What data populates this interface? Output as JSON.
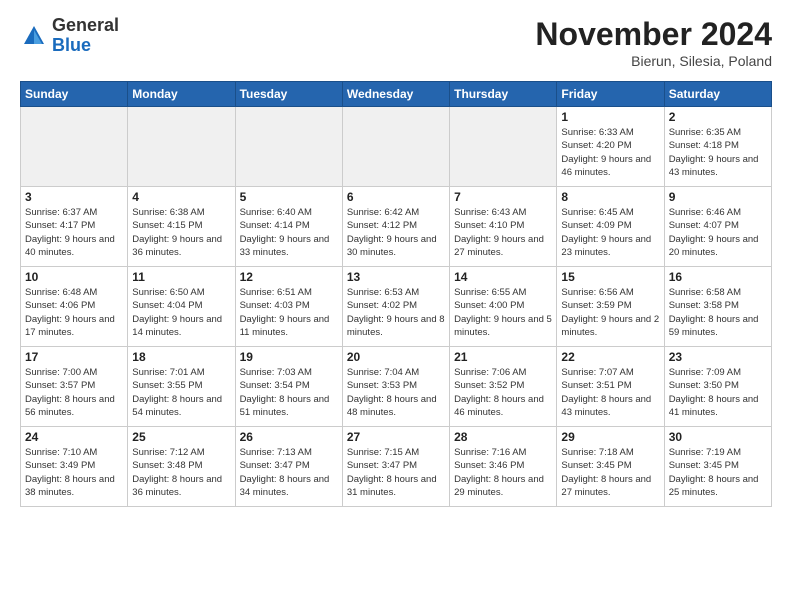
{
  "header": {
    "logo_general": "General",
    "logo_blue": "Blue",
    "month_title": "November 2024",
    "location": "Bierun, Silesia, Poland"
  },
  "weekdays": [
    "Sunday",
    "Monday",
    "Tuesday",
    "Wednesday",
    "Thursday",
    "Friday",
    "Saturday"
  ],
  "weeks": [
    [
      {
        "day": "",
        "info": ""
      },
      {
        "day": "",
        "info": ""
      },
      {
        "day": "",
        "info": ""
      },
      {
        "day": "",
        "info": ""
      },
      {
        "day": "",
        "info": ""
      },
      {
        "day": "1",
        "info": "Sunrise: 6:33 AM\nSunset: 4:20 PM\nDaylight: 9 hours and 46 minutes."
      },
      {
        "day": "2",
        "info": "Sunrise: 6:35 AM\nSunset: 4:18 PM\nDaylight: 9 hours and 43 minutes."
      }
    ],
    [
      {
        "day": "3",
        "info": "Sunrise: 6:37 AM\nSunset: 4:17 PM\nDaylight: 9 hours and 40 minutes."
      },
      {
        "day": "4",
        "info": "Sunrise: 6:38 AM\nSunset: 4:15 PM\nDaylight: 9 hours and 36 minutes."
      },
      {
        "day": "5",
        "info": "Sunrise: 6:40 AM\nSunset: 4:14 PM\nDaylight: 9 hours and 33 minutes."
      },
      {
        "day": "6",
        "info": "Sunrise: 6:42 AM\nSunset: 4:12 PM\nDaylight: 9 hours and 30 minutes."
      },
      {
        "day": "7",
        "info": "Sunrise: 6:43 AM\nSunset: 4:10 PM\nDaylight: 9 hours and 27 minutes."
      },
      {
        "day": "8",
        "info": "Sunrise: 6:45 AM\nSunset: 4:09 PM\nDaylight: 9 hours and 23 minutes."
      },
      {
        "day": "9",
        "info": "Sunrise: 6:46 AM\nSunset: 4:07 PM\nDaylight: 9 hours and 20 minutes."
      }
    ],
    [
      {
        "day": "10",
        "info": "Sunrise: 6:48 AM\nSunset: 4:06 PM\nDaylight: 9 hours and 17 minutes."
      },
      {
        "day": "11",
        "info": "Sunrise: 6:50 AM\nSunset: 4:04 PM\nDaylight: 9 hours and 14 minutes."
      },
      {
        "day": "12",
        "info": "Sunrise: 6:51 AM\nSunset: 4:03 PM\nDaylight: 9 hours and 11 minutes."
      },
      {
        "day": "13",
        "info": "Sunrise: 6:53 AM\nSunset: 4:02 PM\nDaylight: 9 hours and 8 minutes."
      },
      {
        "day": "14",
        "info": "Sunrise: 6:55 AM\nSunset: 4:00 PM\nDaylight: 9 hours and 5 minutes."
      },
      {
        "day": "15",
        "info": "Sunrise: 6:56 AM\nSunset: 3:59 PM\nDaylight: 9 hours and 2 minutes."
      },
      {
        "day": "16",
        "info": "Sunrise: 6:58 AM\nSunset: 3:58 PM\nDaylight: 8 hours and 59 minutes."
      }
    ],
    [
      {
        "day": "17",
        "info": "Sunrise: 7:00 AM\nSunset: 3:57 PM\nDaylight: 8 hours and 56 minutes."
      },
      {
        "day": "18",
        "info": "Sunrise: 7:01 AM\nSunset: 3:55 PM\nDaylight: 8 hours and 54 minutes."
      },
      {
        "day": "19",
        "info": "Sunrise: 7:03 AM\nSunset: 3:54 PM\nDaylight: 8 hours and 51 minutes."
      },
      {
        "day": "20",
        "info": "Sunrise: 7:04 AM\nSunset: 3:53 PM\nDaylight: 8 hours and 48 minutes."
      },
      {
        "day": "21",
        "info": "Sunrise: 7:06 AM\nSunset: 3:52 PM\nDaylight: 8 hours and 46 minutes."
      },
      {
        "day": "22",
        "info": "Sunrise: 7:07 AM\nSunset: 3:51 PM\nDaylight: 8 hours and 43 minutes."
      },
      {
        "day": "23",
        "info": "Sunrise: 7:09 AM\nSunset: 3:50 PM\nDaylight: 8 hours and 41 minutes."
      }
    ],
    [
      {
        "day": "24",
        "info": "Sunrise: 7:10 AM\nSunset: 3:49 PM\nDaylight: 8 hours and 38 minutes."
      },
      {
        "day": "25",
        "info": "Sunrise: 7:12 AM\nSunset: 3:48 PM\nDaylight: 8 hours and 36 minutes."
      },
      {
        "day": "26",
        "info": "Sunrise: 7:13 AM\nSunset: 3:47 PM\nDaylight: 8 hours and 34 minutes."
      },
      {
        "day": "27",
        "info": "Sunrise: 7:15 AM\nSunset: 3:47 PM\nDaylight: 8 hours and 31 minutes."
      },
      {
        "day": "28",
        "info": "Sunrise: 7:16 AM\nSunset: 3:46 PM\nDaylight: 8 hours and 29 minutes."
      },
      {
        "day": "29",
        "info": "Sunrise: 7:18 AM\nSunset: 3:45 PM\nDaylight: 8 hours and 27 minutes."
      },
      {
        "day": "30",
        "info": "Sunrise: 7:19 AM\nSunset: 3:45 PM\nDaylight: 8 hours and 25 minutes."
      }
    ]
  ]
}
